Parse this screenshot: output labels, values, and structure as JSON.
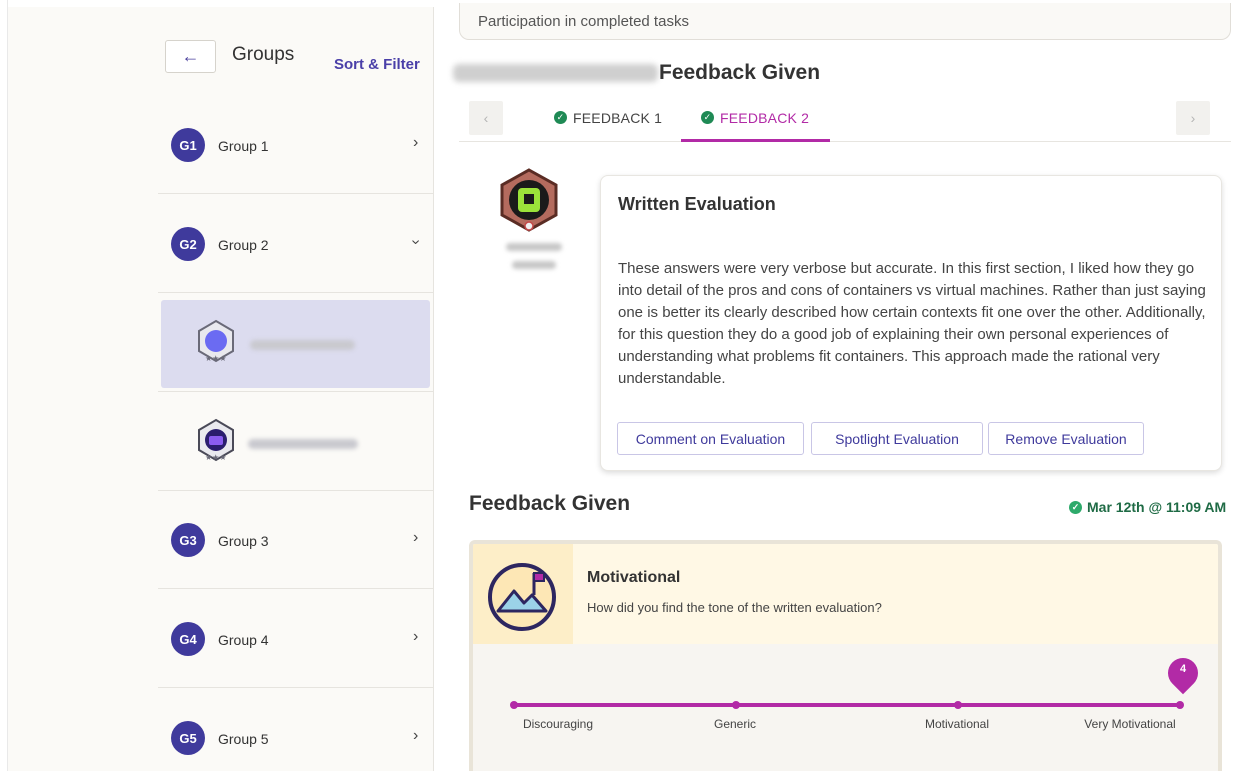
{
  "sidebar": {
    "back_icon": "arrow-left-icon",
    "title": "Groups",
    "sort_filter": "Sort & Filter",
    "groups": [
      {
        "badge": "G1",
        "name": "Group 1",
        "expanded": false
      },
      {
        "badge": "G2",
        "name": "Group 2",
        "expanded": true
      },
      {
        "badge": "G3",
        "name": "Group 3",
        "expanded": false
      },
      {
        "badge": "G4",
        "name": "Group 4",
        "expanded": false
      },
      {
        "badge": "G5",
        "name": "Group 5",
        "expanded": false
      }
    ]
  },
  "main": {
    "participation": "Participation in completed tasks",
    "feedback_title": "Feedback Given",
    "tabs": [
      {
        "label": "FEEDBACK 1",
        "completed": true
      },
      {
        "label": "FEEDBACK 2",
        "completed": true,
        "active": true
      }
    ],
    "evaluation": {
      "heading": "Written Evaluation",
      "body": "These answers were very verbose but accurate. In this first section, I liked how they go into detail of the pros and cons of containers vs virtual machines. Rather than just saying one is better its clearly described how certain contexts fit one over the other. Additionally, for this question they do a good job of explaining their own personal experiences of understanding what problems fit containers. This approach made the rational very understandable.",
      "buttons": [
        "Comment on Evaluation",
        "Spotlight Evaluation",
        "Remove Evaluation"
      ]
    },
    "feedback_given": {
      "heading": "Feedback Given",
      "date": "Mar 12th @ 11:09 AM",
      "question_title": "Motivational",
      "question_text": "How did you find the tone of the written evaluation?",
      "scale": [
        "Discouraging",
        "Generic",
        "Motivational",
        "Very Motivational"
      ],
      "selected_value": "4"
    }
  },
  "colors": {
    "accent": "#b22aa6",
    "brand": "#3f3a9c",
    "success": "#1f8a55"
  }
}
